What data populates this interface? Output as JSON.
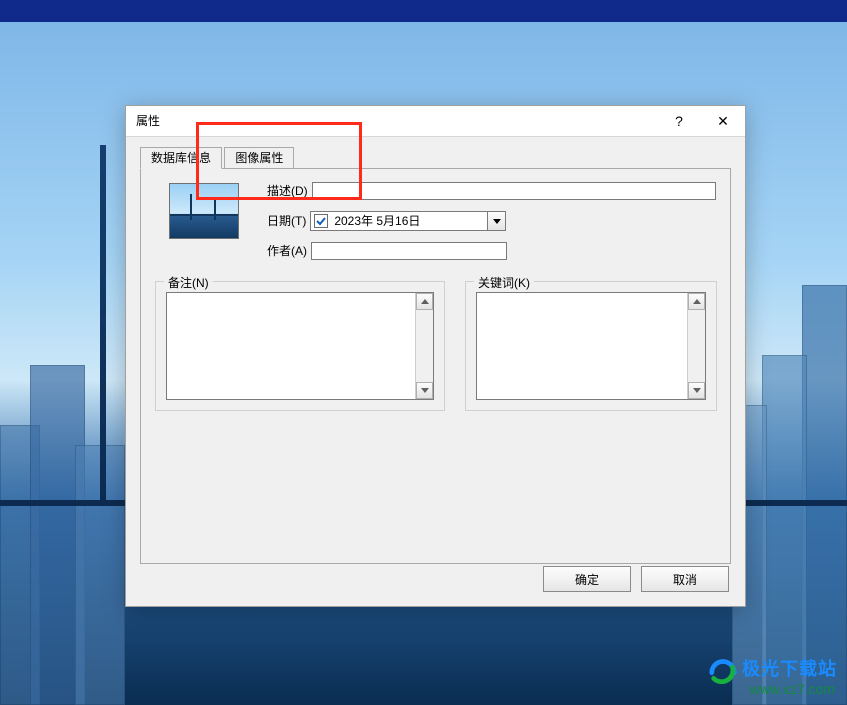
{
  "dialog": {
    "title": "属性",
    "help_glyph": "?",
    "close_glyph": "✕",
    "tabs": [
      {
        "label": "数据库信息"
      },
      {
        "label": "图像属性"
      }
    ],
    "active_tab_index": 0,
    "fields": {
      "description": {
        "label": "描述(D)",
        "value": ""
      },
      "date": {
        "label": "日期(T)",
        "value": "2023年 5月16日",
        "checked": true
      },
      "author": {
        "label": "作者(A)",
        "value": ""
      }
    },
    "groups": {
      "notes": {
        "label": "备注(N)",
        "value": ""
      },
      "keywords": {
        "label": "关键词(K)",
        "value": ""
      }
    },
    "buttons": {
      "ok": "确定",
      "cancel": "取消"
    }
  },
  "watermark": {
    "line1": "极光下载站",
    "line2": "www.xz7.com"
  }
}
